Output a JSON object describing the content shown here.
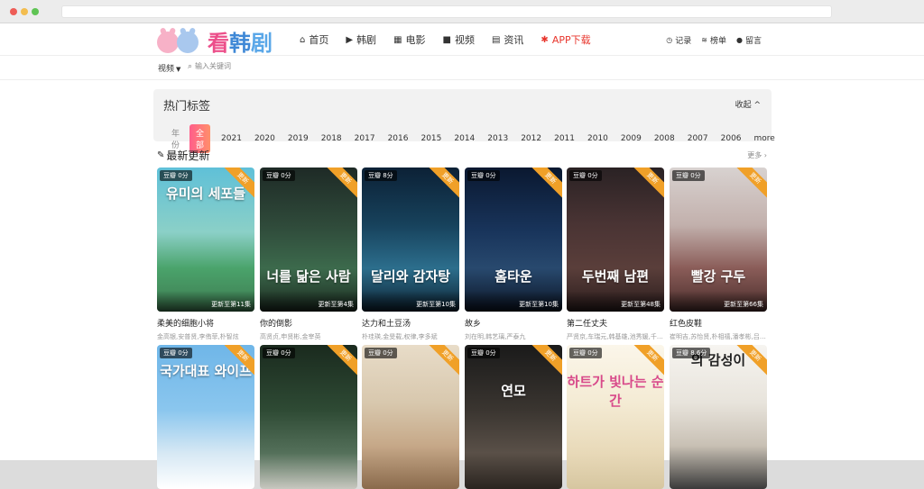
{
  "logo": {
    "part1": "看",
    "part2": "韩",
    "part3": "剧"
  },
  "nav": [
    {
      "label": "首页",
      "icon": "home-icon",
      "glyph": "⌂"
    },
    {
      "label": "韩剧",
      "icon": "play-circle-icon",
      "glyph": "▶"
    },
    {
      "label": "电影",
      "icon": "film-icon",
      "glyph": "▦"
    },
    {
      "label": "视频",
      "icon": "video-camera-icon",
      "glyph": "■"
    },
    {
      "label": "资讯",
      "icon": "newspaper-icon",
      "glyph": "▤"
    },
    {
      "label": "APP下载",
      "icon": "android-icon",
      "glyph": "✱"
    }
  ],
  "right_nav": [
    {
      "label": "记录",
      "icon": "clock-icon",
      "glyph": "◷"
    },
    {
      "label": "榜单",
      "icon": "rss-icon",
      "glyph": "≋"
    },
    {
      "label": "留言",
      "icon": "comment-icon",
      "glyph": "●"
    }
  ],
  "subbar": {
    "category": "视频",
    "search_placeholder": "输入关键词"
  },
  "tags": {
    "title": "热门标签",
    "collapse": "收起",
    "label": "年份",
    "active": "全部",
    "years": [
      "2021",
      "2020",
      "2019",
      "2018",
      "2017",
      "2016",
      "2015",
      "2014",
      "2013",
      "2012",
      "2011",
      "2010",
      "2009",
      "2008",
      "2007",
      "2006",
      "more"
    ]
  },
  "latest": {
    "title": "最新更新",
    "more": "更多 ›"
  },
  "ribbon": "更新",
  "cards": [
    {
      "title": "柔美的细胞小将",
      "cast": "金高银,安普贤,李侑菲,朴智炫",
      "rating": "豆瓣 0分",
      "episode": "更新至第11集",
      "poster_text": "유미의 세포들",
      "bg": "linear-gradient(180deg,#5fc0d8 0%,#8bd0c7 45%,#4aa36b 70%,#3e7a50 100%)"
    },
    {
      "title": "你的倒影",
      "cast": "高贤贞,申贤彬,金宰英",
      "rating": "豆瓣 0分",
      "episode": "更新至第4集",
      "poster_text": "너를 닮은 사람",
      "bg": "linear-gradient(180deg,#1e2a26 0%,#2f4a3a 40%,#3c6a4c 70%,#1b2a20 100%)"
    },
    {
      "title": "达力和土豆汤",
      "cast": "朴珪瑛,金旻载,权律,李多斌",
      "rating": "豆瓣 8分",
      "episode": "更新至第10集",
      "poster_text": "달리와 감자탕",
      "bg": "linear-gradient(180deg,#0c2136 0%,#17425c 40%,#2c6e8c 70%,#0c2030 100%)"
    },
    {
      "title": "故乡",
      "cast": "刘在明,韩艺璃,严泰九",
      "rating": "豆瓣 0分",
      "episode": "更新至第10集",
      "poster_text": "홈타운",
      "bg": "linear-gradient(180deg,#0a1830 0%,#19355c 45%,#28496e 70%,#0b1424 100%)"
    },
    {
      "title": "第二任丈夫",
      "cast": "严贤京,车瑞元,韩基雄,池秀媛,千…",
      "rating": "豆瓣 0分",
      "episode": "更新至第48集",
      "poster_text": "두번째 남편",
      "bg": "linear-gradient(180deg,#2a2224 0%,#4a3434 40%,#5a3e3a 70%,#2a1c1c 100%)"
    },
    {
      "title": "红色皮鞋",
      "cast": "崔明吉,苏怡贤,朴相禧,潘孝彬,吕…",
      "rating": "豆瓣 0分",
      "episode": "更新至第66集",
      "poster_text": "빨강 구두",
      "bg": "linear-gradient(180deg,#d8d2d0 0%,#c2b0ac 40%,#8a5c58 70%,#4a2e2c 100%)"
    },
    {
      "title": "",
      "cast": "",
      "rating": "豆瓣 0分",
      "episode": "",
      "poster_text": "국가대표 와이프",
      "bg": "linear-gradient(180deg,#6fb6e8 0%,#8ac6ee 45%,#d6e8f4 75%,#ffffff 100%)"
    },
    {
      "title": "",
      "cast": "",
      "rating": "豆瓣 0分",
      "episode": "",
      "poster_text": "",
      "bg": "linear-gradient(180deg,#1a2a1e 0%,#2e4a34 45%,#54705a 75%,#c8c8c0 100%)"
    },
    {
      "title": "",
      "cast": "",
      "rating": "豆瓣 0分",
      "episode": "",
      "poster_text": "",
      "bg": "linear-gradient(180deg,#e8dcc8 0%,#d8c8ae 40%,#c6a888 70%,#8a6a4c 100%)"
    },
    {
      "title": "",
      "cast": "",
      "rating": "豆瓣 0分",
      "episode": "",
      "poster_text": "연모",
      "bg": "linear-gradient(180deg,#1a1a1a 0%,#3a3530 45%,#5a5048 75%,#2a2420 100%)"
    },
    {
      "title": "",
      "cast": "",
      "rating": "豆瓣 0分",
      "episode": "",
      "poster_text": "하트가 빛나는 순간",
      "bg": "linear-gradient(180deg,#fbf6ea 0%,#f4ebd4 40%,#e8d9b8 75%,#d6c6a0 100%)"
    },
    {
      "title": "",
      "cast": "",
      "rating": "豆瓣 8.6分",
      "episode": "",
      "poster_text": "의 감성이",
      "bg": "linear-gradient(180deg,#f6f4f0 0%,#e8e4dc 40%,#c8c0b4 70%,#3a3a3a 100%)"
    }
  ]
}
